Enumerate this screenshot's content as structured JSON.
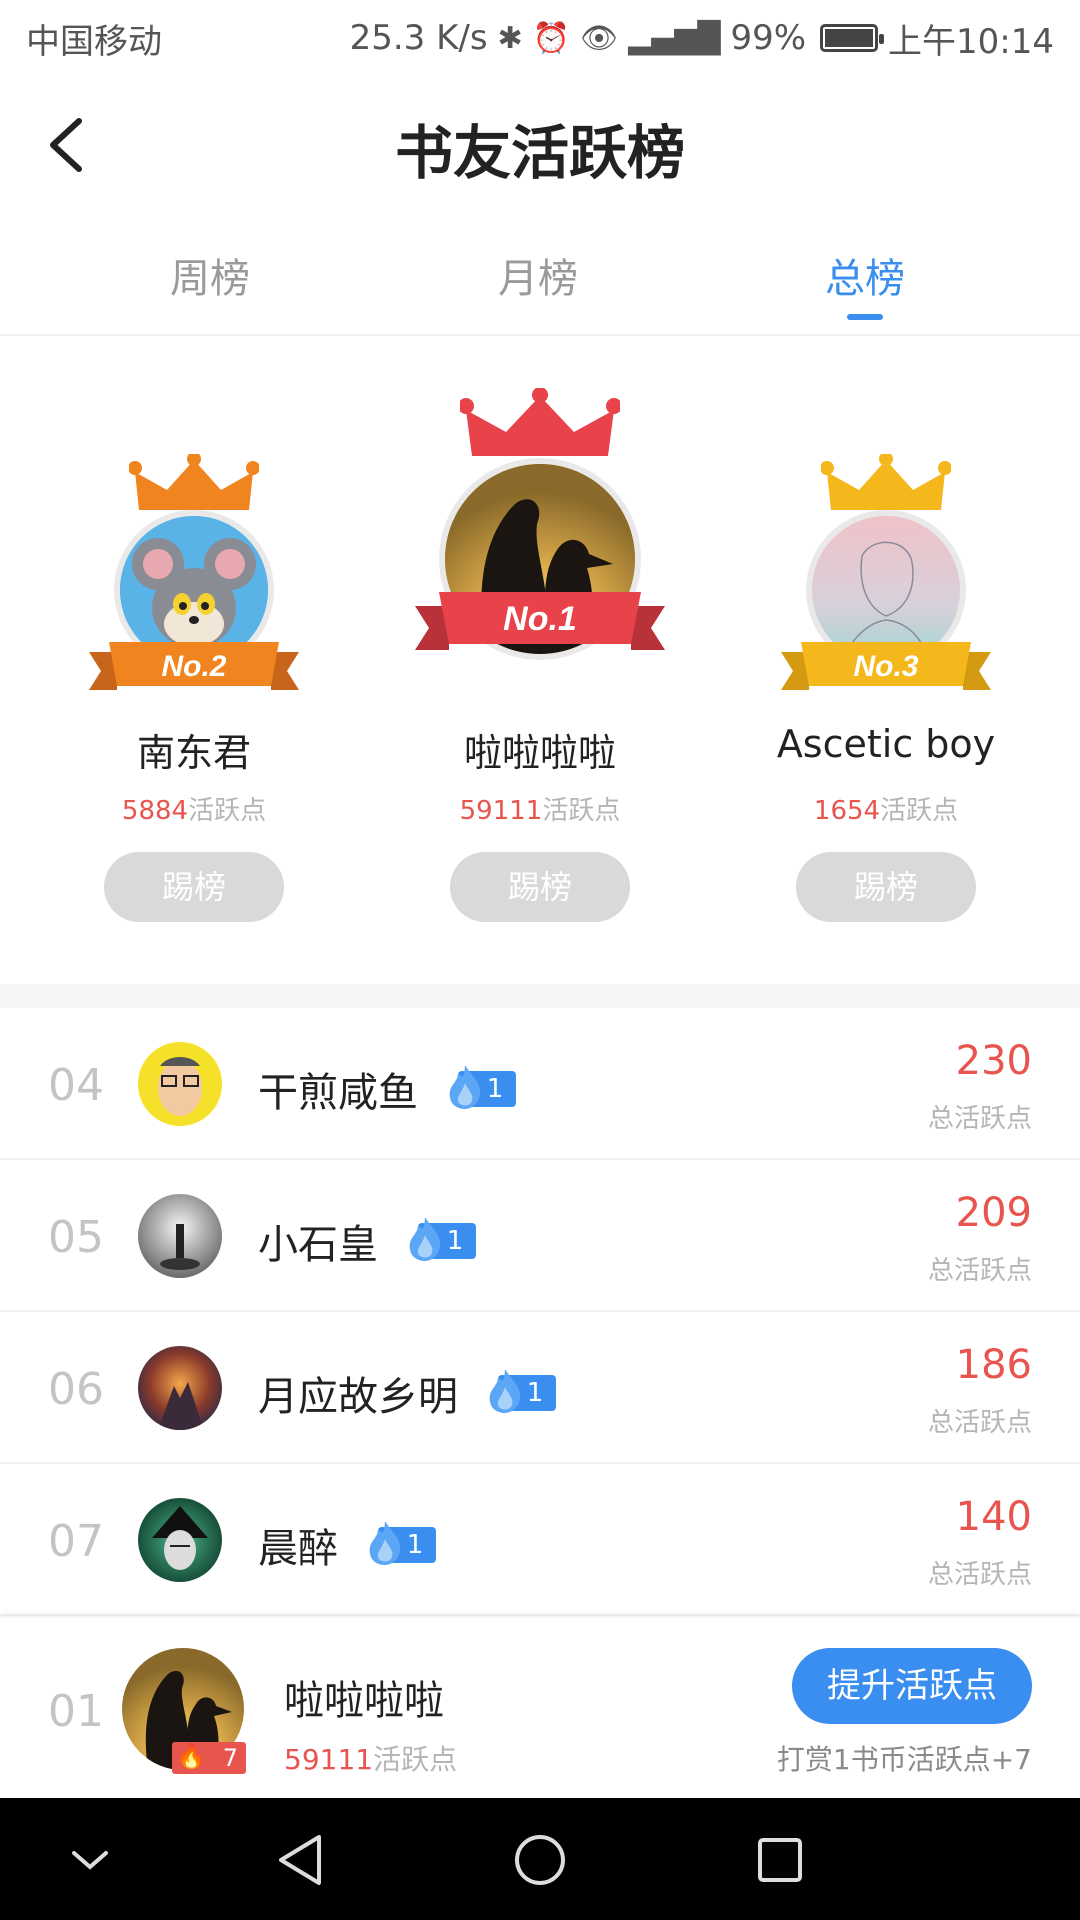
{
  "status_bar": {
    "carrier": "中国移动",
    "speed": "25.3 K/s",
    "battery": "99%",
    "time": "上午10:14"
  },
  "header": {
    "title": "书友活跃榜"
  },
  "tabs": [
    {
      "label": "周榜",
      "active": false
    },
    {
      "label": "月榜",
      "active": false
    },
    {
      "label": "总榜",
      "active": true
    }
  ],
  "podium": [
    {
      "rank_label": "No.2",
      "name": "南东君",
      "points": "5884",
      "points_unit": "活跃点",
      "kick_label": "踢榜",
      "ribbon_color": "#f0851f",
      "crown_color": "#f0851f"
    },
    {
      "rank_label": "No.1",
      "name": "啦啦啦啦",
      "points": "59111",
      "points_unit": "活跃点",
      "kick_label": "踢榜",
      "ribbon_color": "#e8424a",
      "crown_color": "#e8424a"
    },
    {
      "rank_label": "No.3",
      "name": "Ascetic boy",
      "points": "1654",
      "points_unit": "活跃点",
      "kick_label": "踢榜",
      "ribbon_color": "#f5b81c",
      "crown_color": "#f5b81c"
    }
  ],
  "list": [
    {
      "rank": "04",
      "name": "干煎咸鱼",
      "badge": "1",
      "score": "230",
      "score_label": "总活跃点"
    },
    {
      "rank": "05",
      "name": "小石皇",
      "badge": "1",
      "score": "209",
      "score_label": "总活跃点"
    },
    {
      "rank": "06",
      "name": "月应故乡明",
      "badge": "1",
      "score": "186",
      "score_label": "总活跃点"
    },
    {
      "rank": "07",
      "name": "晨醉",
      "badge": "1",
      "score": "140",
      "score_label": "总活跃点"
    }
  ],
  "me": {
    "rank": "01",
    "name": "啦啦啦啦",
    "fire": "7",
    "points": "59111",
    "points_unit": "活跃点",
    "boost_label": "提升活跃点",
    "tip": "打赏1书币活跃点+7"
  },
  "colors": {
    "accent": "#3a8ef0",
    "score_red": "#e8544e"
  }
}
